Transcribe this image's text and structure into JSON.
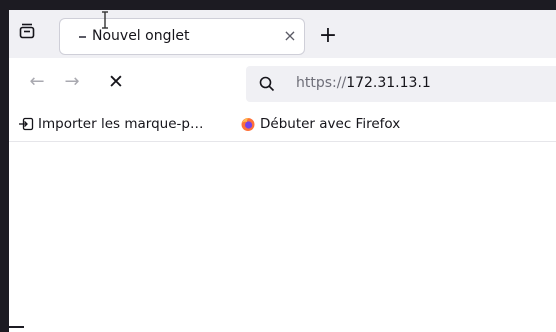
{
  "tabbar": {
    "tab_manager_icon": "tab-list-icon",
    "active_tab": {
      "title": "Nouvel onglet",
      "close_label": "×"
    },
    "new_tab_label": "+"
  },
  "navbar": {
    "back_label": "←",
    "forward_label": "→",
    "stop_label": "✕",
    "url": {
      "scheme": "https://",
      "host": "172.31.13.1"
    }
  },
  "bookmarks": {
    "items": [
      {
        "label": "Importer les marque-p…",
        "icon": "import-icon"
      },
      {
        "label": "Débuter avec Firefox",
        "icon": "firefox-icon"
      }
    ]
  }
}
